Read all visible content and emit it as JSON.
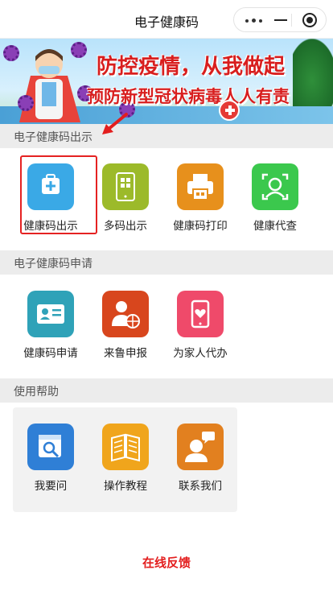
{
  "app": {
    "title": "电子健康码"
  },
  "banner": {
    "line1": "防控疫情，从我做起",
    "line2": "预防新型冠状病毒人人有责"
  },
  "sections": {
    "show": {
      "title": "电子健康码出示",
      "items": [
        {
          "label": "健康码出示",
          "color": "#3aa9e6",
          "icon": "medical-kit-icon"
        },
        {
          "label": "多码出示",
          "color": "#9cba2a",
          "icon": "multi-qr-phone-icon"
        },
        {
          "label": "健康码打印",
          "color": "#e7901c",
          "icon": "printer-icon"
        },
        {
          "label": "健康代查",
          "color": "#3bc84d",
          "icon": "face-scan-icon"
        }
      ]
    },
    "apply": {
      "title": "电子健康码申请",
      "items": [
        {
          "label": "健康码申请",
          "color": "#2fa2b8",
          "icon": "id-card-icon"
        },
        {
          "label": "来鲁申报",
          "color": "#d8461d",
          "icon": "person-globe-icon"
        },
        {
          "label": "为家人代办",
          "color": "#ef4a6a",
          "icon": "phone-heart-icon"
        }
      ]
    },
    "help": {
      "title": "使用帮助",
      "items": [
        {
          "label": "我要问",
          "color": "#2f7fd6",
          "icon": "calendar-search-icon"
        },
        {
          "label": "操作教程",
          "color": "#f0a51c",
          "icon": "book-icon"
        },
        {
          "label": "联系我们",
          "color": "#e2801f",
          "icon": "customer-service-icon"
        }
      ]
    }
  },
  "footer": {
    "feedback": "在线反馈"
  }
}
